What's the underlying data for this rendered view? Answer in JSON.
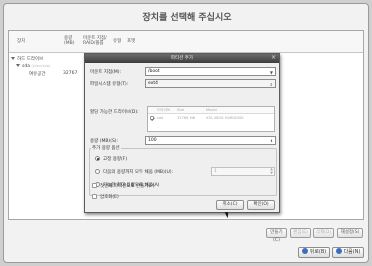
{
  "page": {
    "title": "장치를 선택해 주십시오"
  },
  "tree": {
    "columns": [
      "장치",
      "용량\n(MB)",
      "마운트 지점/\nRAID/볼륨",
      "유형",
      "포맷"
    ],
    "rows": [
      {
        "label": "하드 드라이브",
        "size": ""
      },
      {
        "label": "sda",
        "sublabel": "(/dev/sda)",
        "size": ""
      },
      {
        "label": "여유공간",
        "size": "32767"
      }
    ]
  },
  "bottom_buttons": {
    "create": "만들기(C)",
    "edit": "편집(E)",
    "delete": "삭제(D)",
    "reset": "재설정(S)"
  },
  "nav": {
    "back": "뒤로(B)",
    "next": "다음(N)"
  },
  "dialog": {
    "title": "파티션 추가",
    "mount_point_label": "마운트 지점(M):",
    "mount_point_value": "/boot",
    "fs_type_label": "파일시스템 유형(T):",
    "fs_type_value": "ext4",
    "drives_label": "할당 가능한 드라이브(D):",
    "drives_columns": [
      "드라이브",
      "Size",
      "Model"
    ],
    "drives_rows": [
      {
        "checked": true,
        "drive": "sda",
        "size": "32768 MB",
        "model": "ATA VBOX HARDDISK"
      }
    ],
    "size_label": "용량 (MB)(S):",
    "size_value": "100",
    "options_label": "추가 용량 옵션",
    "opt_fixed": "고정 용량(F)",
    "opt_fill_upto": "다음의 용량까지 모두 채움 (MB)(U):",
    "opt_fill_upto_value": "1",
    "opt_fill_max": "가능한 최대 용량으로 채움(A)",
    "primary_label": "첫번째 파티션으로 만들기(P)",
    "encrypt_label": "암호화(E)",
    "cancel": "취소(C)",
    "ok": "확인(O)"
  },
  "colors": {
    "title_bar": "#4a4a4a",
    "background": "#f2f2f2"
  }
}
